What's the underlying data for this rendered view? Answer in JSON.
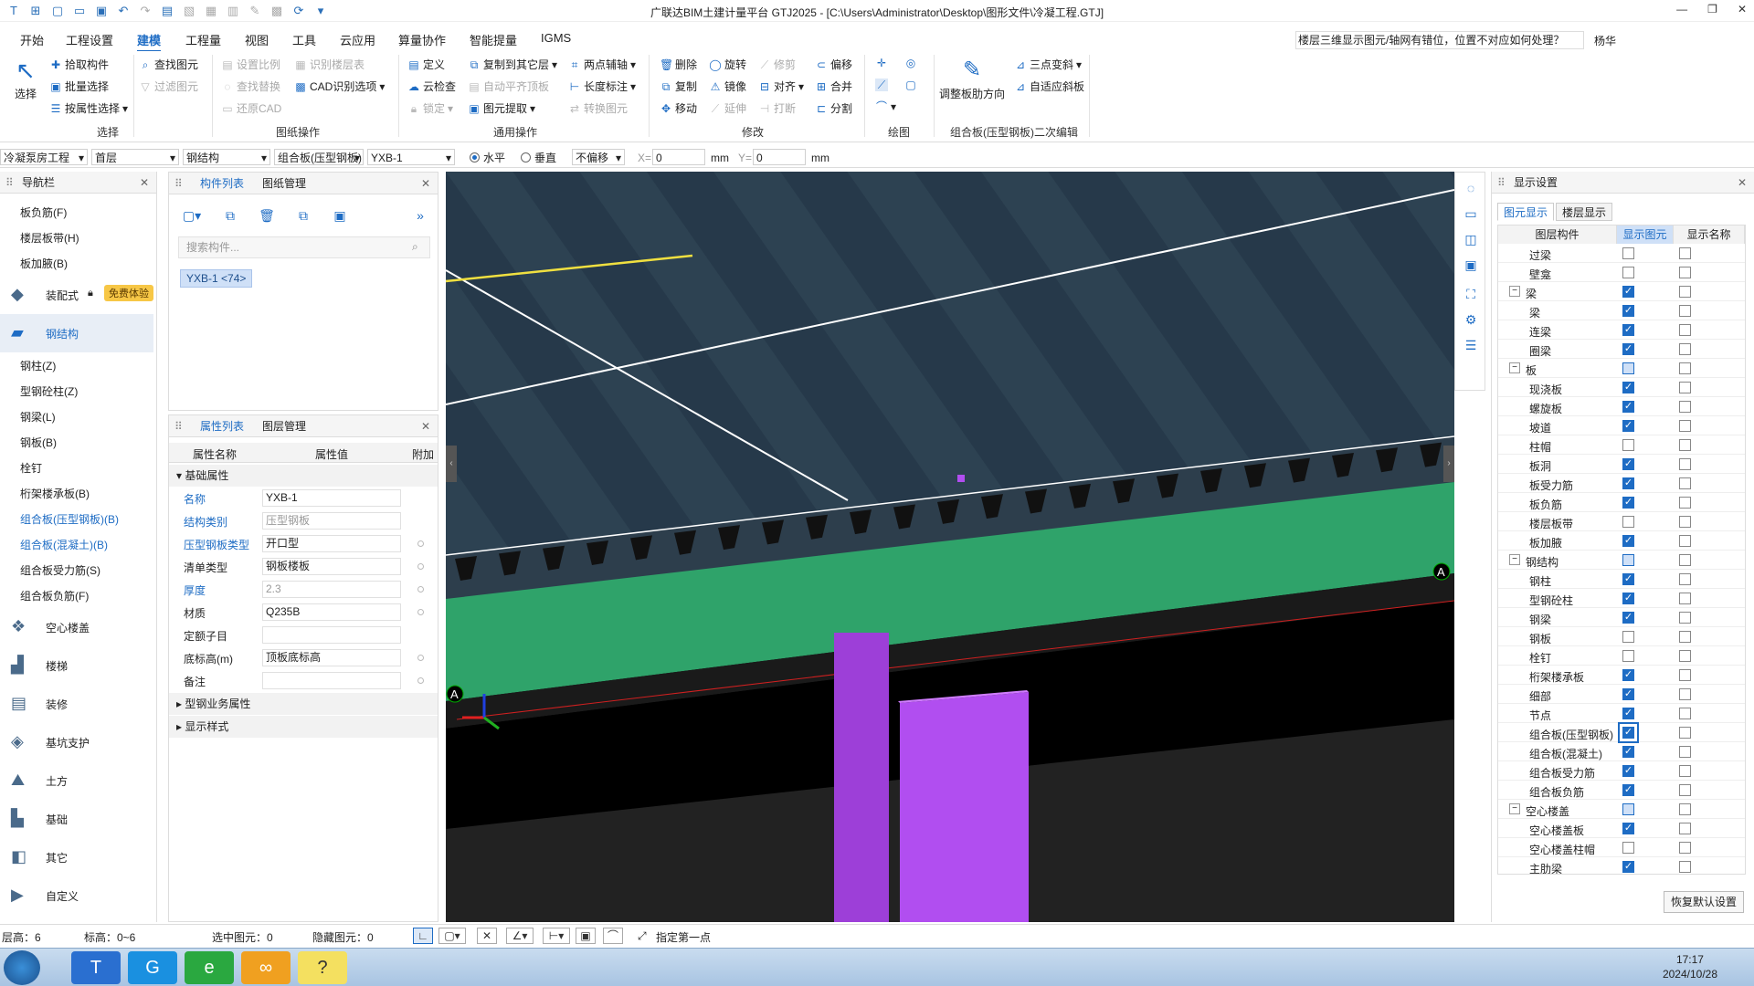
{
  "title": "广联达BIM土建计量平台 GTJ2025 - [C:\\Users\\Administrator\\Desktop\\图形文件\\冷凝工程.GTJ]",
  "menu": [
    "开始",
    "工程设置",
    "建模",
    "工程量",
    "视图",
    "工具",
    "云应用",
    "算量协作",
    "智能提量",
    "IGMS"
  ],
  "help_text": "楼层三维显示图元/轴网有错位，位置不对应如何处理？",
  "user": "杨华",
  "ribbon": {
    "select": {
      "pick": "拾取构件",
      "batch": "批量选择",
      "by_attr": "按属性选择",
      "select": "选择",
      "group": "选择"
    },
    "drawing": {
      "find": "查找图元",
      "filter": "过滤图元",
      "set_scale": "设置比例",
      "find_replace": "查找替换",
      "restore_cad": "还原CAD",
      "identify_floor": "识别楼层表",
      "cad_options": "CAD识别选项",
      "group": "图纸操作"
    },
    "general": {
      "define": "定义",
      "cloud_check": "云检查",
      "lock": "锁定",
      "copy_floor": "复制到其它层",
      "auto_flat": "自动平齐顶板",
      "extract": "图元提取",
      "two_point_axis": "两点辅轴",
      "length_mark": "长度标注",
      "convert": "转换图元",
      "group": "通用操作"
    },
    "modify": {
      "delete": "删除",
      "rotate": "旋转",
      "trim": "修剪",
      "offset": "偏移",
      "copy": "复制",
      "mirror": "镜像",
      "align": "对齐",
      "merge": "合并",
      "move": "移动",
      "extend": "延伸",
      "break": "打断",
      "split": "分割",
      "group": "修改"
    },
    "draw": {
      "group": "绘图"
    },
    "secondary": {
      "adjust_dir": "调整板肋方向",
      "three_point_slope": "三点变斜",
      "auto_slope": "自适应斜板",
      "group": "组合板(压型钢板)二次编辑"
    }
  },
  "propbar": {
    "project": "冷凝泵房工程",
    "floor": "首层",
    "category": "钢结构",
    "type": "组合板(压型钢板)",
    "name": "YXB-1",
    "horizontal": "水平",
    "vertical": "垂直",
    "offset": "不偏移",
    "x_label": "X=",
    "x_val": "0",
    "y_label": "Y=",
    "y_val": "0",
    "unit": "mm"
  },
  "nav": {
    "title": "导航栏",
    "top_items": [
      "板负筋(F)",
      "楼层板带(H)",
      "板加腋(B)"
    ],
    "assembly": "装配式",
    "free_badge": "免费体验",
    "steel": "钢结构",
    "steel_items": [
      "钢柱(Z)",
      "型钢砼柱(Z)",
      "钢梁(L)",
      "钢板(B)",
      "栓钉",
      "桁架楼承板(B)",
      "组合板(压型钢板)(B)",
      "组合板(混凝土)(B)",
      "组合板受力筋(S)",
      "组合板负筋(F)"
    ],
    "categories": [
      "空心楼盖",
      "楼梯",
      "装修",
      "基坑支护",
      "土方",
      "基础",
      "其它",
      "自定义"
    ]
  },
  "component_panel": {
    "tab1": "构件列表",
    "tab2": "图纸管理",
    "search_placeholder": "搜索构件...",
    "chip": "YXB-1 <74>"
  },
  "props_panel": {
    "tab1": "属性列表",
    "tab2": "图层管理",
    "headers": [
      "属性名称",
      "属性值",
      "附加"
    ],
    "section_basic": "基础属性",
    "rows": [
      {
        "name": "名称",
        "value": "YXB-1"
      },
      {
        "name": "结构类别",
        "value": "压型钢板"
      },
      {
        "name": "压型钢板类型",
        "value": "开口型"
      },
      {
        "name": "清单类型",
        "value": "钢板楼板"
      },
      {
        "name": "厚度",
        "value": "2.3"
      },
      {
        "name": "材质",
        "value": "Q235B"
      },
      {
        "name": "定额子目",
        "value": ""
      },
      {
        "name": "底标高(m)",
        "value": "顶板底标高"
      },
      {
        "name": "备注",
        "value": ""
      }
    ],
    "section_steel": "型钢业务属性",
    "section_style": "显示样式"
  },
  "viewport": {
    "axis_label": "A"
  },
  "display": {
    "title": "显示设置",
    "tab1": "图元显示",
    "tab2": "楼层显示",
    "headers": [
      "图层构件",
      "显示图元",
      "显示名称"
    ],
    "rows": [
      {
        "name": "过梁",
        "lvl": 2,
        "a": "off",
        "b": "off"
      },
      {
        "name": "壁龛",
        "lvl": 2,
        "a": "off",
        "b": "off"
      },
      {
        "name": "梁",
        "lvl": 1,
        "a": "on",
        "b": "off"
      },
      {
        "name": "梁",
        "lvl": 2,
        "a": "on",
        "b": "off"
      },
      {
        "name": "连梁",
        "lvl": 2,
        "a": "on",
        "b": "off"
      },
      {
        "name": "圈梁",
        "lvl": 2,
        "a": "on",
        "b": "off"
      },
      {
        "name": "板",
        "lvl": 1,
        "a": "part",
        "b": "off"
      },
      {
        "name": "现浇板",
        "lvl": 2,
        "a": "on",
        "b": "off"
      },
      {
        "name": "螺旋板",
        "lvl": 2,
        "a": "on",
        "b": "off"
      },
      {
        "name": "坡道",
        "lvl": 2,
        "a": "on",
        "b": "off"
      },
      {
        "name": "柱帽",
        "lvl": 2,
        "a": "off",
        "b": "off"
      },
      {
        "name": "板洞",
        "lvl": 2,
        "a": "on",
        "b": "off"
      },
      {
        "name": "板受力筋",
        "lvl": 2,
        "a": "on",
        "b": "off"
      },
      {
        "name": "板负筋",
        "lvl": 2,
        "a": "on",
        "b": "off"
      },
      {
        "name": "楼层板带",
        "lvl": 2,
        "a": "off",
        "b": "off"
      },
      {
        "name": "板加腋",
        "lvl": 2,
        "a": "on",
        "b": "off"
      },
      {
        "name": "钢结构",
        "lvl": 1,
        "a": "part",
        "b": "off"
      },
      {
        "name": "钢柱",
        "lvl": 2,
        "a": "on",
        "b": "off"
      },
      {
        "name": "型钢砼柱",
        "lvl": 2,
        "a": "on",
        "b": "off"
      },
      {
        "name": "钢梁",
        "lvl": 2,
        "a": "on",
        "b": "off"
      },
      {
        "name": "钢板",
        "lvl": 2,
        "a": "off",
        "b": "off"
      },
      {
        "name": "栓钉",
        "lvl": 2,
        "a": "off",
        "b": "off"
      },
      {
        "name": "桁架楼承板",
        "lvl": 2,
        "a": "on",
        "b": "off"
      },
      {
        "name": "细部",
        "lvl": 2,
        "a": "on",
        "b": "off"
      },
      {
        "name": "节点",
        "lvl": 2,
        "a": "on",
        "b": "off"
      },
      {
        "name": "组合板(压型钢板)",
        "lvl": 2,
        "a": "on",
        "b": "off",
        "hl": true
      },
      {
        "name": "组合板(混凝土)",
        "lvl": 2,
        "a": "on",
        "b": "off"
      },
      {
        "name": "组合板受力筋",
        "lvl": 2,
        "a": "on",
        "b": "off"
      },
      {
        "name": "组合板负筋",
        "lvl": 2,
        "a": "on",
        "b": "off"
      },
      {
        "name": "空心楼盖",
        "lvl": 1,
        "a": "part",
        "b": "off"
      },
      {
        "name": "空心楼盖板",
        "lvl": 2,
        "a": "on",
        "b": "off"
      },
      {
        "name": "空心楼盖柱帽",
        "lvl": 2,
        "a": "off",
        "b": "off"
      },
      {
        "name": "主肋梁",
        "lvl": 2,
        "a": "on",
        "b": "off"
      }
    ],
    "restore": "恢复默认设置"
  },
  "status": {
    "floor_height": "层高：6",
    "elevation": "标高：0~6",
    "selected": "选中图元：0",
    "hidden": "隐藏图元：0",
    "hint": "指定第一点"
  },
  "clock": {
    "time": "17:17",
    "date": "2024/10/28"
  },
  "colors": {
    "accent": "#1e6cc4",
    "slab_green": "#2fa36a",
    "steel_purple": "#b14ef0",
    "deck_dark": "#263a48"
  }
}
